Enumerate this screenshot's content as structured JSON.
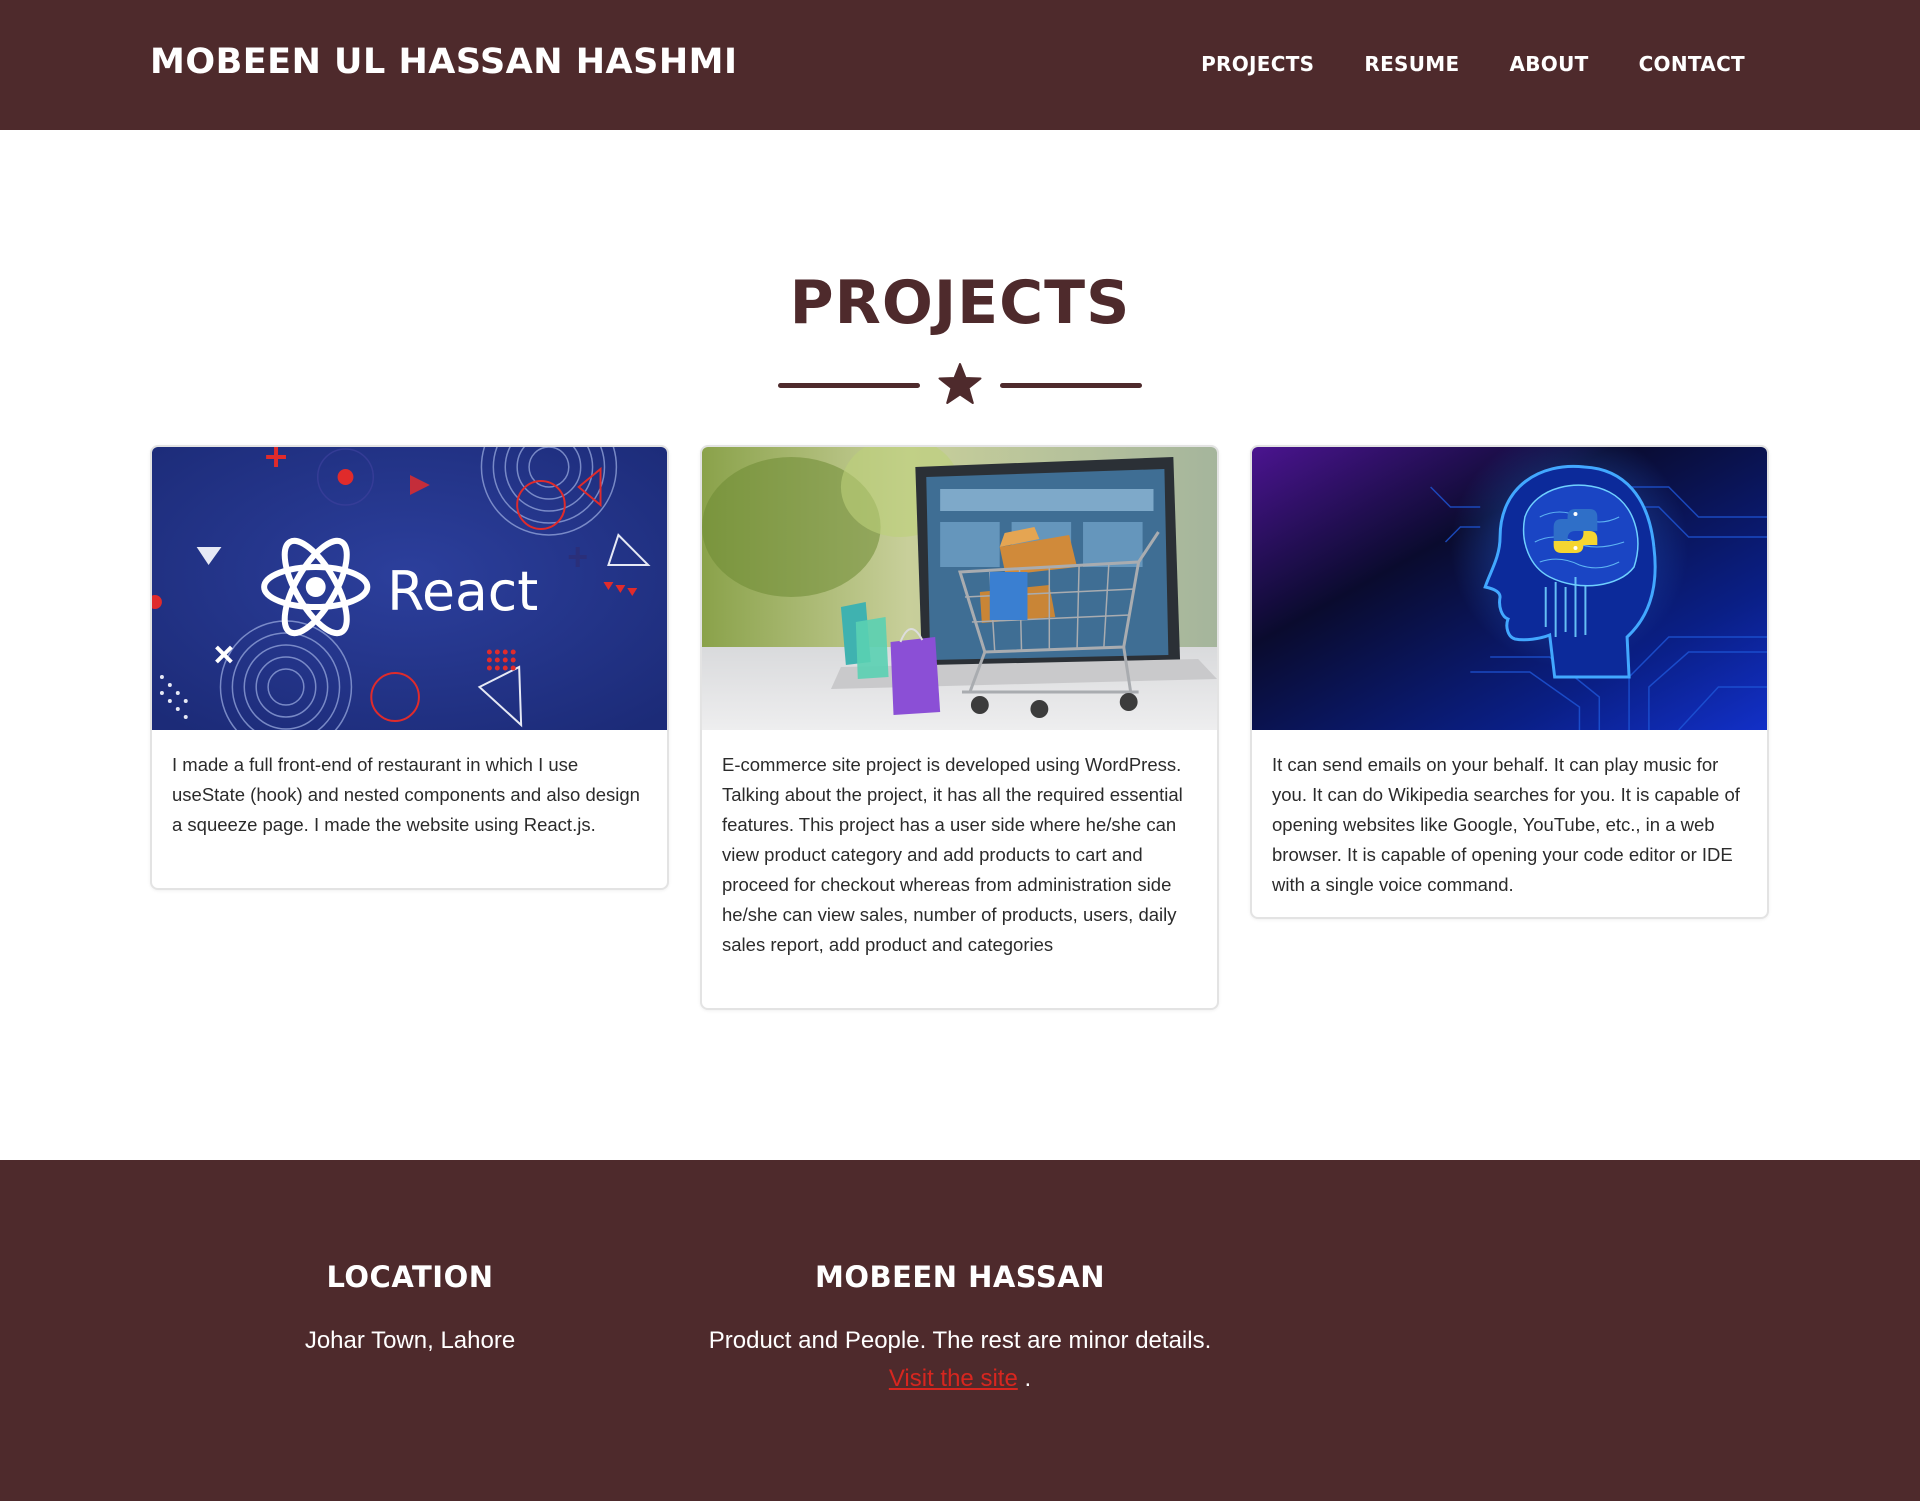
{
  "header": {
    "brand": "MOBEEN UL HASSAN HASHMI",
    "nav": [
      {
        "label": "PROJECTS"
      },
      {
        "label": "RESUME"
      },
      {
        "label": "ABOUT"
      },
      {
        "label": "CONTACT"
      }
    ]
  },
  "colors": {
    "primary": "#4e2a2c",
    "link": "#d7261f"
  },
  "projects": {
    "title": "PROJECTS",
    "divider_icon": "star-icon",
    "cards": [
      {
        "image_label": "React",
        "description": "I made a full front-end of restaurant in which I use useState (hook) and nested components and also design a squeeze page. I made the website using React.js."
      },
      {
        "description": "E-commerce site project is developed using WordPress. Talking about the project, it has all the required essential features. This project has a user side where he/she can view product category and add products to cart and proceed for checkout whereas from administration side he/she can view sales, number of products, users, daily sales report, add product and categories"
      },
      {
        "description": "It can send emails on your behalf. It can play music for you. It can do Wikipedia searches for you. It is capable of opening websites like Google, YouTube, etc., in a web browser. It is capable of opening your code editor or IDE with a single voice command."
      }
    ]
  },
  "footer": {
    "location": {
      "heading": "LOCATION",
      "text": "Johar Town, Lahore"
    },
    "about": {
      "heading": "MOBEEN HASSAN",
      "text": "Product and People. The rest are minor details.",
      "link_label": "Visit the site",
      "after_link": " ."
    }
  }
}
